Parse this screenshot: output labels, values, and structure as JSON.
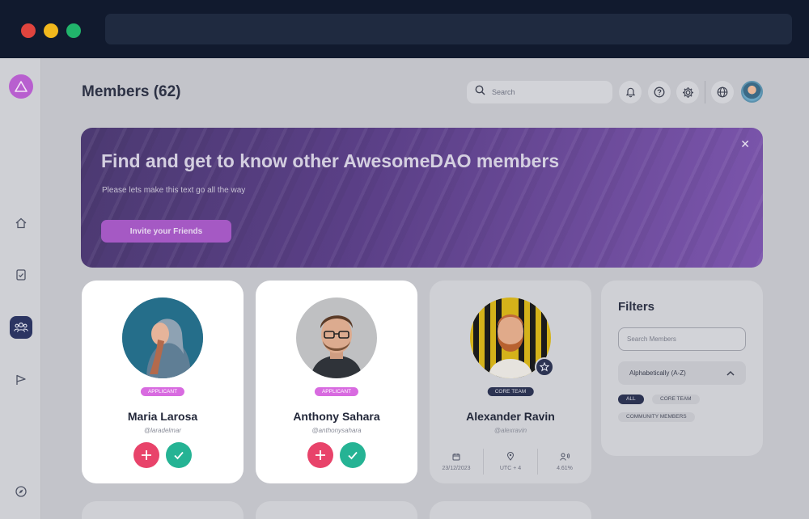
{
  "header": {
    "title": "Members (62)"
  },
  "search": {
    "placeholder": "Search"
  },
  "banner": {
    "title": "Find and get to know other AwesomeDAO members",
    "subtitle": "Please lets make this text go all the way",
    "cta_label": "Invite your Friends",
    "close_label": "✕"
  },
  "members": [
    {
      "name": "Maria Larosa",
      "handle": "@laradelmar",
      "badge": "APPLICANT"
    },
    {
      "name": "Anthony Sahara",
      "handle": "@anthonysahara",
      "badge": "APPLICANT"
    },
    {
      "name": "Alexander Ravin",
      "handle": "@alexravin",
      "badge": "CORE TEAM",
      "stats": {
        "date": "23/12/2023",
        "timezone": "UTC + 4",
        "score": "4.61%"
      }
    }
  ],
  "filters": {
    "title": "Filters",
    "search_placeholder": "Search Members",
    "sort_label": "Alphabetically (A-Z)",
    "chips": [
      "ALL",
      "CORE TEAM",
      "COMMUNITY MEMBERS"
    ]
  },
  "colors": {
    "accent": "#b85fcf",
    "applicant_badge": "#d86be0",
    "core_badge": "#2c3352",
    "add_button": "#e8436a",
    "approve_button": "#25b394"
  },
  "icons": {
    "sidebar": [
      "home-icon",
      "tasks-icon",
      "members-icon",
      "flag-icon",
      "compass-icon"
    ],
    "topbar": [
      "search-icon",
      "bell-icon",
      "help-icon",
      "gear-icon",
      "globe-icon"
    ]
  }
}
